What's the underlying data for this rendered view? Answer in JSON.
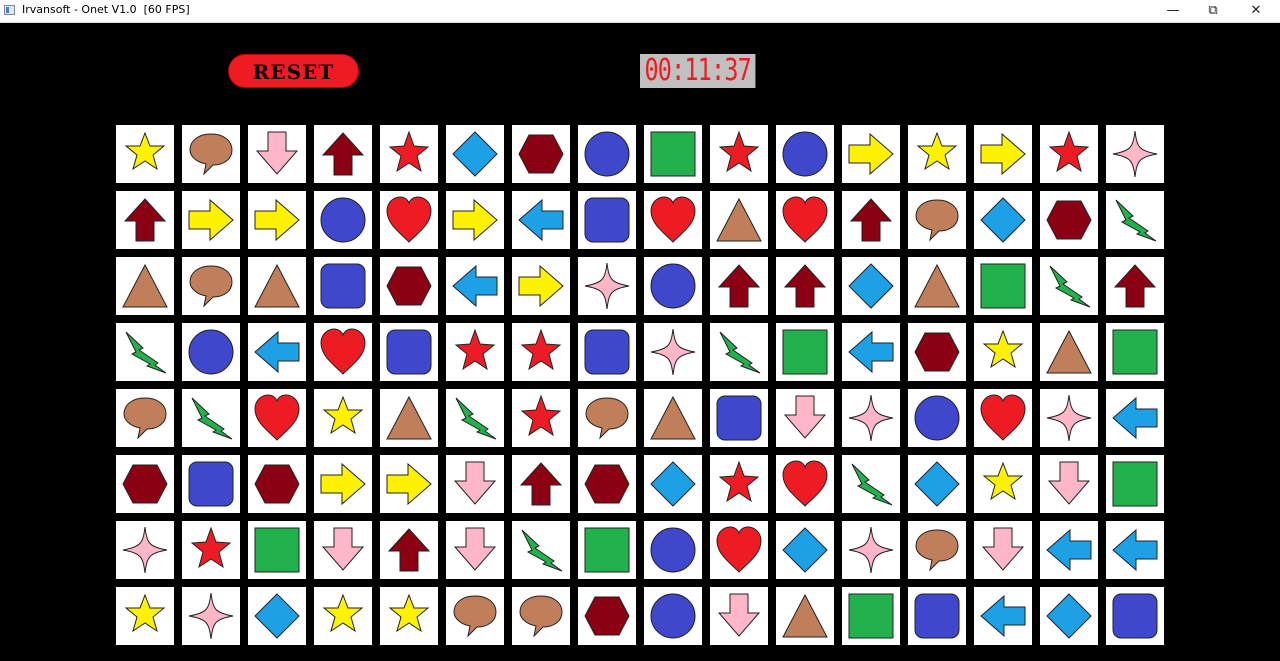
{
  "window": {
    "title": "Irvansoft - Onet V1.0  [60 FPS]",
    "minimize_glyph": "—",
    "maximize_glyph": "⧉",
    "close_glyph": "✕"
  },
  "controls": {
    "reset_label": "RESET",
    "timer": "00:11:37"
  },
  "colors": {
    "background": "#000000",
    "tile": "#ffffff",
    "reset": "#ed1c24",
    "timer_text": "#ed1c24",
    "timer_bg": "#c0c0c0"
  },
  "board": {
    "rows": 8,
    "cols": 16,
    "tiles": [
      [
        "star-yellow",
        "speech-bubble",
        "arrow-down-pink",
        "arrow-up-maroon",
        "star-red",
        "diamond-blue",
        "hexagon-maroon",
        "circle-blue",
        "square-green",
        "star-red",
        "circle-blue",
        "arrow-right-yellow",
        "star-yellow",
        "arrow-right-yellow",
        "star-red",
        "sparkle-pink"
      ],
      [
        "arrow-up-maroon",
        "arrow-right-yellow",
        "arrow-right-yellow",
        "circle-blue",
        "heart-red",
        "arrow-right-yellow",
        "arrow-left-blue",
        "rounded-square-blue",
        "heart-red",
        "triangle-brown",
        "heart-red",
        "arrow-up-maroon",
        "speech-bubble",
        "diamond-blue",
        "hexagon-maroon",
        "lightning-green"
      ],
      [
        "triangle-brown",
        "speech-bubble",
        "triangle-brown",
        "rounded-square-blue",
        "hexagon-maroon",
        "arrow-left-blue",
        "arrow-right-yellow",
        "sparkle-pink",
        "circle-blue",
        "arrow-up-maroon",
        "arrow-up-maroon",
        "diamond-blue",
        "triangle-brown",
        "square-green",
        "lightning-green",
        "arrow-up-maroon"
      ],
      [
        "lightning-green",
        "circle-blue",
        "arrow-left-blue",
        "heart-red",
        "rounded-square-blue",
        "star-red",
        "star-red",
        "rounded-square-blue",
        "sparkle-pink",
        "lightning-green",
        "square-green",
        "arrow-left-blue",
        "hexagon-maroon",
        "star-yellow",
        "triangle-brown",
        "square-green"
      ],
      [
        "speech-bubble",
        "lightning-green",
        "heart-red",
        "star-yellow",
        "triangle-brown",
        "lightning-green",
        "star-red",
        "speech-bubble",
        "triangle-brown",
        "rounded-square-blue",
        "arrow-down-pink",
        "sparkle-pink",
        "circle-blue",
        "heart-red",
        "sparkle-pink",
        "arrow-left-blue"
      ],
      [
        "hexagon-maroon",
        "rounded-square-blue",
        "hexagon-maroon",
        "arrow-right-yellow",
        "arrow-right-yellow",
        "arrow-down-pink",
        "arrow-up-maroon",
        "hexagon-maroon",
        "diamond-blue",
        "star-red",
        "heart-red",
        "lightning-green",
        "diamond-blue",
        "star-yellow",
        "arrow-down-pink",
        "square-green"
      ],
      [
        "sparkle-pink",
        "star-red",
        "square-green",
        "arrow-down-pink",
        "arrow-up-maroon",
        "arrow-down-pink",
        "lightning-green",
        "square-green",
        "circle-blue",
        "heart-red",
        "diamond-blue",
        "sparkle-pink",
        "speech-bubble",
        "arrow-down-pink",
        "arrow-left-blue",
        "arrow-left-blue"
      ],
      [
        "star-yellow",
        "sparkle-pink",
        "diamond-blue",
        "star-yellow",
        "star-yellow",
        "speech-bubble",
        "speech-bubble",
        "hexagon-maroon",
        "circle-blue",
        "arrow-down-pink",
        "triangle-brown",
        "square-green",
        "rounded-square-blue",
        "arrow-left-blue",
        "diamond-blue",
        "rounded-square-blue"
      ]
    ]
  }
}
